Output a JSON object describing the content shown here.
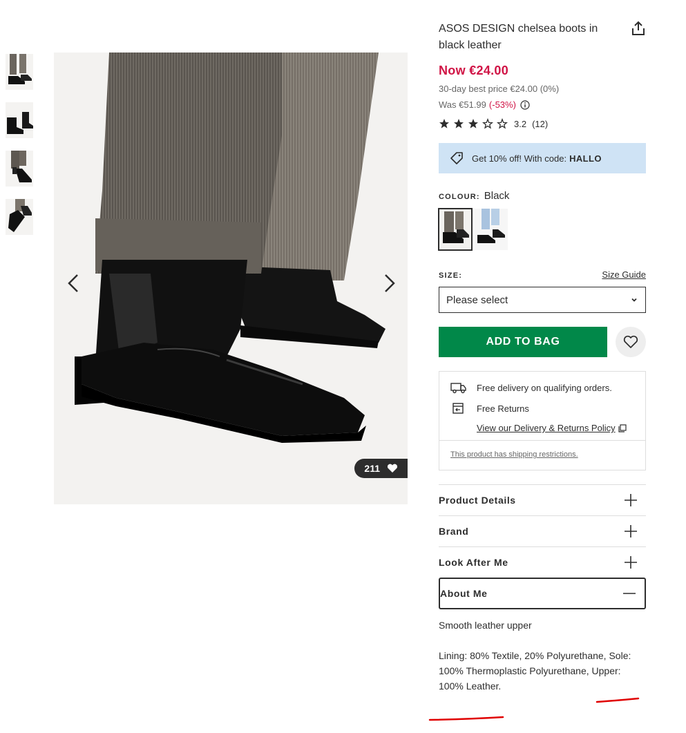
{
  "product": {
    "title": "ASOS DESIGN chelsea boots in black leather",
    "price_now": "Now €24.00",
    "best_price": "30-day best price €24.00 (0%)",
    "was_price": "Was €51.99",
    "was_discount": "(-53%)",
    "rating_value": "3.2",
    "rating_count": "(12)",
    "rating_stars": 3,
    "saves_count": "211"
  },
  "promo": {
    "text": "Get 10% off! With code:",
    "code": "HALLO"
  },
  "colour": {
    "label": "COLOUR:",
    "value": "Black"
  },
  "size": {
    "label": "SIZE:",
    "guide": "Size Guide",
    "placeholder": "Please select"
  },
  "actions": {
    "add_to_bag": "ADD TO BAG"
  },
  "delivery": {
    "free_delivery": "Free delivery on qualifying orders.",
    "free_returns": "Free Returns",
    "policy_link": "View our Delivery & Returns Policy",
    "restriction": "This product has shipping restrictions."
  },
  "accordion": {
    "product_details": "Product Details",
    "brand": "Brand",
    "look_after_me": "Look After Me",
    "about_me": "About Me"
  },
  "about": {
    "summary": "Smooth leather upper",
    "composition": "Lining: 80% Textile, 20% Polyurethane, Sole: 100% Thermoplastic Polyurethane, Upper: 100% Leather."
  },
  "colors": {
    "price_red": "#d01345",
    "cta_green": "#018849",
    "promo_blue": "#cfe3f5",
    "annotation_red": "#e00000"
  },
  "icons": [
    "share-icon",
    "info-icon",
    "star-icon",
    "tag-icon",
    "heart-icon",
    "truck-icon",
    "returns-icon",
    "external-link-icon",
    "plus-icon",
    "minus-icon",
    "chevron-down-icon",
    "chevron-left-icon",
    "chevron-right-icon"
  ]
}
